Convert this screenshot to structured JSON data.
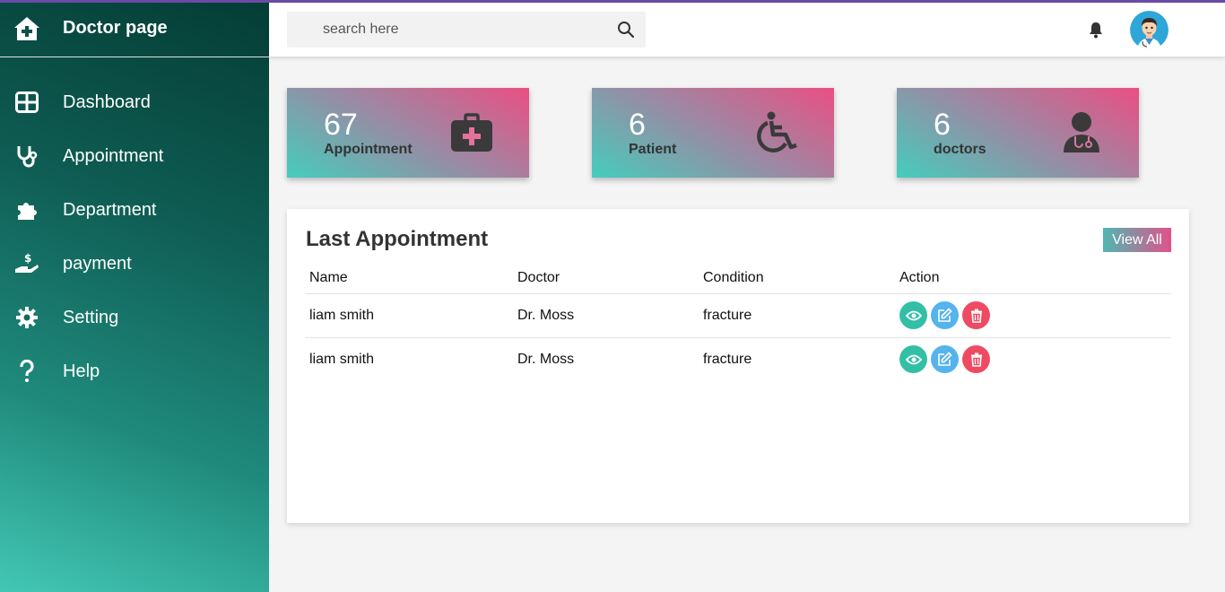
{
  "sidebar": {
    "brand": "Doctor page",
    "items": [
      {
        "label": "Dashboard",
        "icon": "grid-icon"
      },
      {
        "label": "Appointment",
        "icon": "stethoscope-icon"
      },
      {
        "label": "Department",
        "icon": "puzzle-icon"
      },
      {
        "label": "payment",
        "icon": "hand-dollar-icon"
      },
      {
        "label": "Setting",
        "icon": "gear-icon"
      },
      {
        "label": "Help",
        "icon": "question-icon"
      }
    ]
  },
  "header": {
    "search_placeholder": "search here"
  },
  "cards": [
    {
      "value": "67",
      "label": "Appointment",
      "icon": "medical-kit-icon"
    },
    {
      "value": "6",
      "label": "Patient",
      "icon": "wheelchair-icon"
    },
    {
      "value": "6",
      "label": "doctors",
      "icon": "doctor-icon"
    }
  ],
  "appointments": {
    "title": "Last Appointment",
    "view_all": "View All",
    "columns": [
      "Name",
      "Doctor",
      "Condition",
      "Action"
    ],
    "rows": [
      {
        "name": "liam smith",
        "doctor": "Dr. Moss",
        "condition": "fracture"
      },
      {
        "name": "liam smith",
        "doctor": "Dr. Moss",
        "condition": "fracture"
      }
    ]
  },
  "colors": {
    "accent_top": "#6b4aa8",
    "view_button": "#32bfa6",
    "edit_button": "#55b3ee",
    "delete_button": "#ee4b62"
  }
}
